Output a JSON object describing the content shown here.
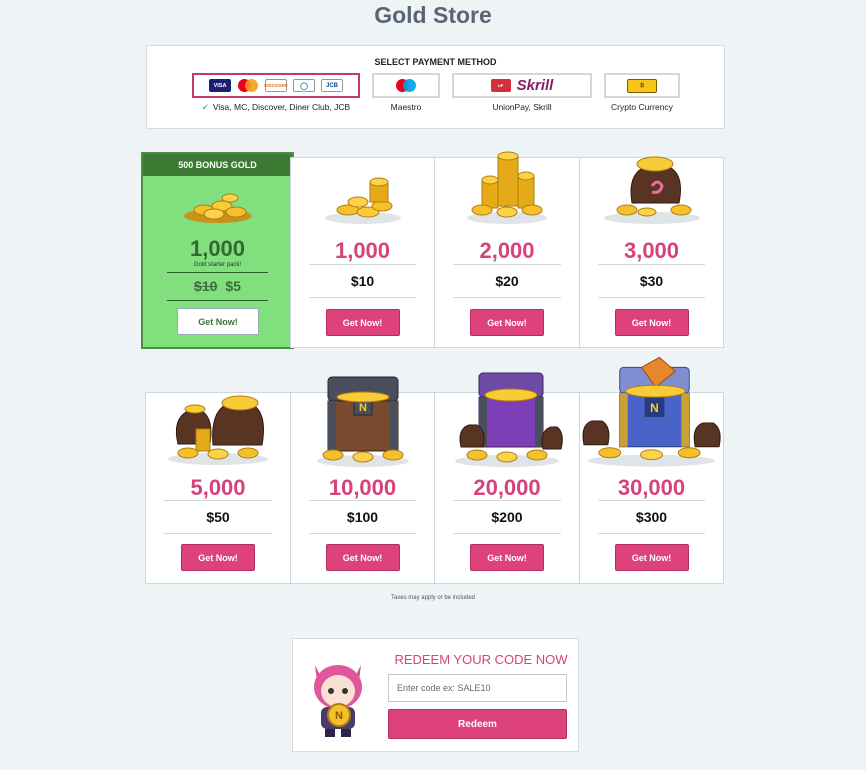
{
  "page": {
    "title": "Gold Store"
  },
  "payment": {
    "heading": "SELECT PAYMENT METHOD",
    "options": [
      {
        "caption": "Visa, MC, Discover, Diner Club, JCB",
        "selected": true,
        "logos": [
          "VISA",
          "mastercard",
          "DISCOVER",
          "Diners Club",
          "JCB"
        ]
      },
      {
        "caption": "Maestro",
        "selected": false,
        "logos": [
          "maestro"
        ]
      },
      {
        "caption": "UnionPay, Skrill",
        "selected": false,
        "logos": [
          "UnionPay",
          "Skrill"
        ]
      },
      {
        "caption": "Crypto Currency",
        "selected": false,
        "logos": [
          "crypto-currency"
        ]
      }
    ]
  },
  "featured": {
    "banner": "500 BONUS GOLD",
    "amount": "1,000",
    "subtitle": "Gold starter pack!",
    "old_price": "$10",
    "new_price": "$5",
    "button": "Get Now!"
  },
  "packs": [
    {
      "amount": "1,000",
      "price": "$10",
      "button": "Get Now!",
      "icon": "small-coin-pile-icon"
    },
    {
      "amount": "2,000",
      "price": "$20",
      "button": "Get Now!",
      "icon": "coin-stack-icon"
    },
    {
      "amount": "3,000",
      "price": "$30",
      "button": "Get Now!",
      "icon": "coin-bag-icon"
    },
    {
      "amount": "5,000",
      "price": "$50",
      "button": "Get Now!",
      "icon": "coin-bags-icon"
    },
    {
      "amount": "10,000",
      "price": "$100",
      "button": "Get Now!",
      "icon": "wooden-chest-icon"
    },
    {
      "amount": "20,000",
      "price": "$200",
      "button": "Get Now!",
      "icon": "purple-chest-icon"
    },
    {
      "amount": "30,000",
      "price": "$300",
      "button": "Get Now!",
      "icon": "blue-chest-icon"
    }
  ],
  "taxes_note": "Taxes may apply or be included",
  "redeem": {
    "title": "REDEEM YOUR CODE NOW",
    "placeholder": "Enter code ex: SALE10",
    "button": "Redeem"
  },
  "colors": {
    "accent": "#de427d",
    "amount": "#d7427b",
    "featured_bg": "#82df7e",
    "featured_banner": "#3d7a33",
    "title": "#596574"
  }
}
